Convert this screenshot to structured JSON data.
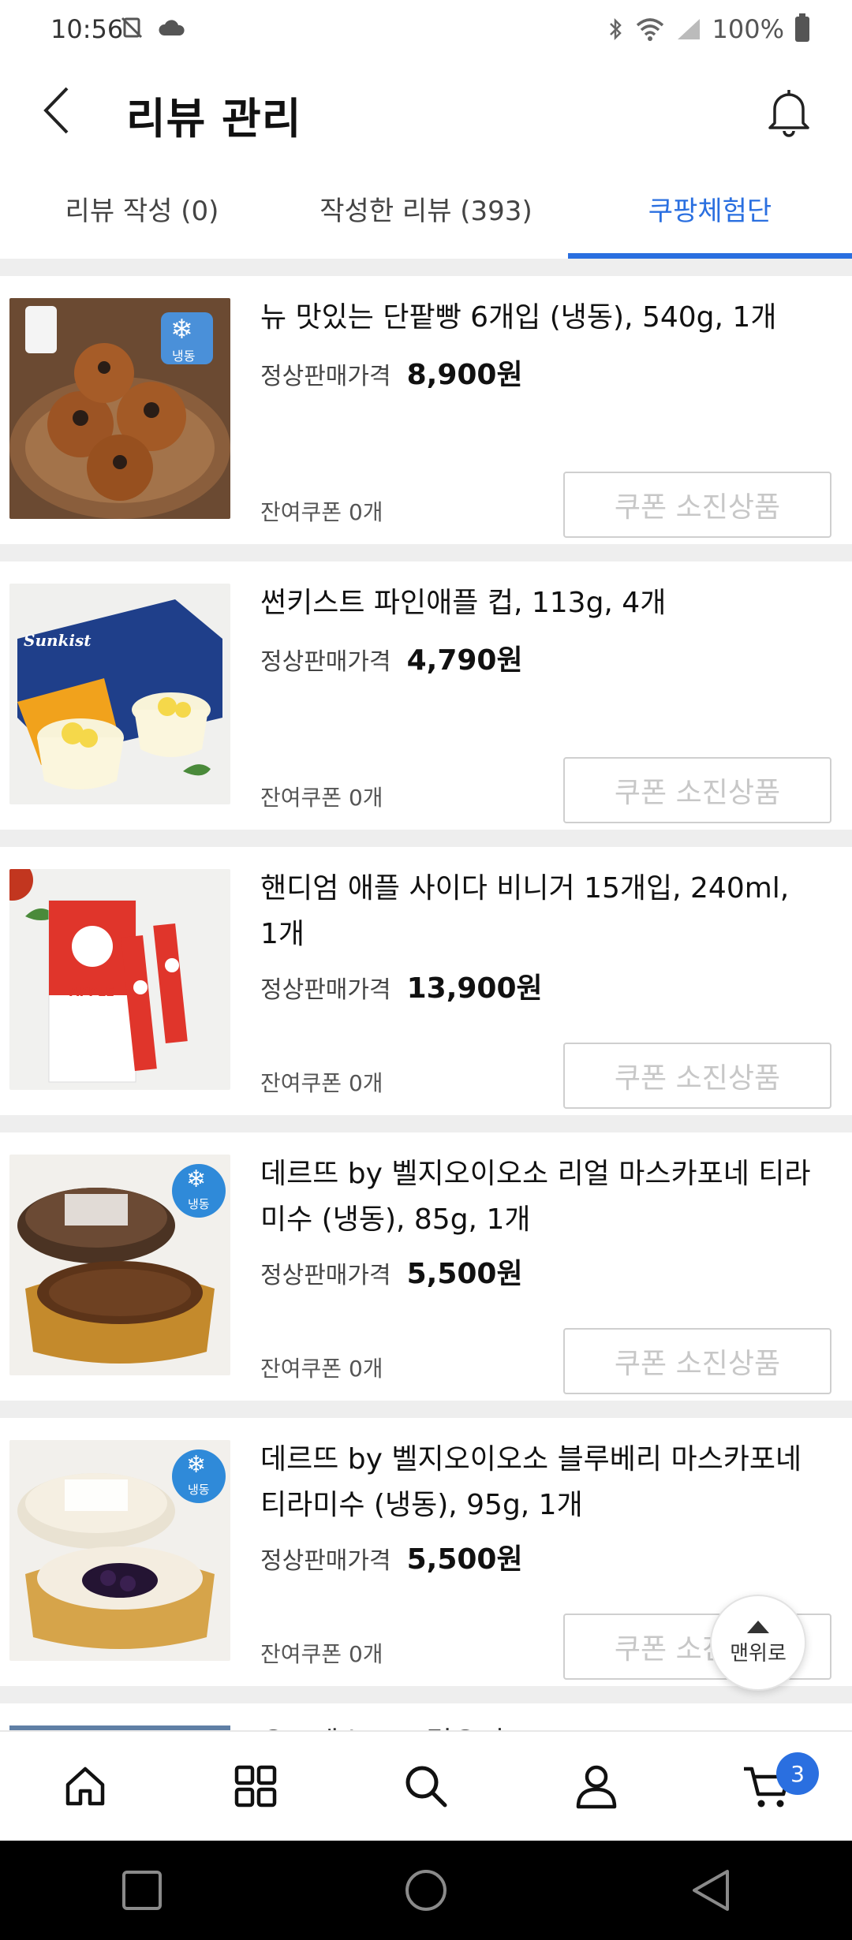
{
  "status_bar": {
    "time": "10:56",
    "battery": "100%"
  },
  "header": {
    "title": "리뷰 관리"
  },
  "tabs": [
    {
      "label": "리뷰 작성 (0)"
    },
    {
      "label": "작성한 리뷰 (393)"
    },
    {
      "label": "쿠팡체험단"
    }
  ],
  "items": [
    {
      "name": "뉴 맛있는 단팥빵 6개입 (냉동), 540g, 1개",
      "price_label": "정상판매가격",
      "price": "8,900원",
      "coupon_left": "잔여쿠폰 0개",
      "button": "쿠폰 소진상품",
      "frozen_badge": "냉동"
    },
    {
      "name": "썬키스트 파인애플 컵, 113g, 4개",
      "price_label": "정상판매가격",
      "price": "4,790원",
      "coupon_left": "잔여쿠폰 0개",
      "button": "쿠폰 소진상품",
      "brand": "Sunkist"
    },
    {
      "name": "핸디엄 애플 사이다 비니거 15개입, 240ml, 1개",
      "price_label": "정상판매가격",
      "price": "13,900원",
      "coupon_left": "잔여쿠폰 0개",
      "button": "쿠폰 소진상품",
      "box_text": "APPLE"
    },
    {
      "name": "데르뜨 by 벨지오이오소 리얼 마스카포네 티라미수 (냉동), 85g, 1개",
      "price_label": "정상판매가격",
      "price": "5,500원",
      "coupon_left": "잔여쿠폰 0개",
      "button": "쿠폰 소진상품",
      "frozen_badge": "냉동"
    },
    {
      "name": "데르뜨 by 벨지오이오소 블루베리 마스카포네 티라미수 (냉동), 95g, 1개",
      "price_label": "정상판매가격",
      "price": "5,500원",
      "coupon_left": "잔여쿠폰 0개",
      "button": "쿠폰 소진상품",
      "frozen_badge": "냉동"
    }
  ],
  "partial_item": {
    "name": "요프레스토 그릭요거트..."
  },
  "scroll_top": {
    "label": "맨위로"
  },
  "bottom_nav": {
    "cart_count": "3"
  },
  "colors": {
    "accent": "#2a6fe0",
    "divider": "#eeeeee"
  }
}
